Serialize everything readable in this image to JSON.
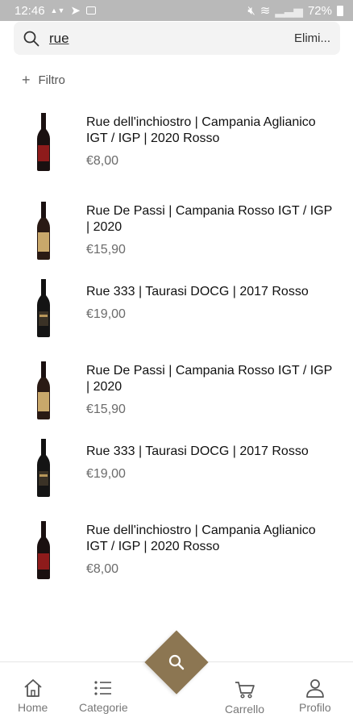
{
  "status": {
    "time": "12:46",
    "battery": "72%"
  },
  "search": {
    "query": "rue",
    "clear_label": "Elimi..."
  },
  "filter": {
    "label": "Filtro"
  },
  "products": [
    {
      "title": "Rue dell'inchiostro | Campania Aglianico IGT / IGP | 2020 Rosso",
      "price": "€8,00",
      "bottle": "dark-red"
    },
    {
      "title": "Rue De Passi | Campania Rosso IGT / IGP | 2020",
      "price": "€15,90",
      "bottle": "gold-label"
    },
    {
      "title": "Rue 333 | Taurasi DOCG | 2017 Rosso",
      "price": "€19,00",
      "bottle": "dark-gold"
    },
    {
      "title": "Rue De Passi | Campania Rosso IGT / IGP | 2020",
      "price": "€15,90",
      "bottle": "gold-label"
    },
    {
      "title": "Rue 333 | Taurasi DOCG | 2017 Rosso",
      "price": "€19,00",
      "bottle": "dark-gold"
    },
    {
      "title": "Rue dell'inchiostro | Campania Aglianico IGT / IGP | 2020 Rosso",
      "price": "€8,00",
      "bottle": "dark-red"
    }
  ],
  "tabs": [
    {
      "label": "Home",
      "icon": "home-icon"
    },
    {
      "label": "Categorie",
      "icon": "list-icon"
    },
    {
      "label": "Carrello",
      "icon": "cart-icon"
    },
    {
      "label": "Profilo",
      "icon": "user-icon"
    }
  ],
  "colors": {
    "accent": "#8c7652",
    "price": "#6b6b6b",
    "statusbar": "#b9b9b9"
  }
}
